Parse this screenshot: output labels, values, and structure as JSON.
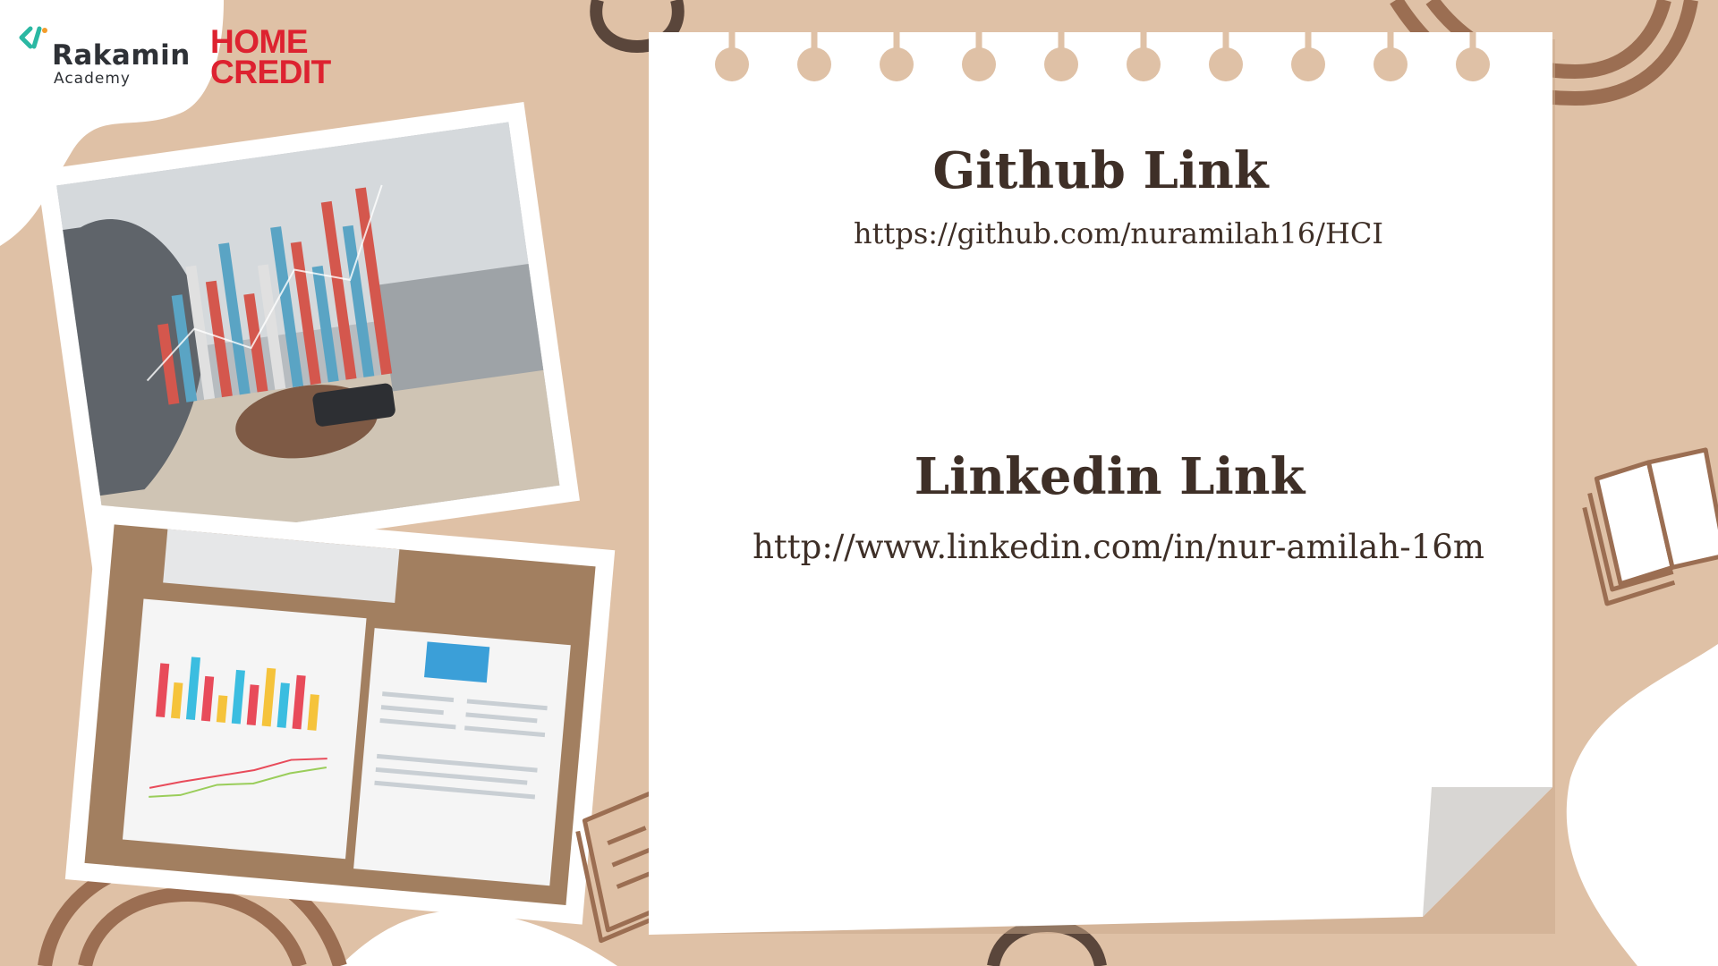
{
  "brand": {
    "rakamin_name": "Rakamin",
    "rakamin_sub": "Academy",
    "home_credit_line1": "HOME",
    "home_credit_line2": "CREDIT",
    "home_credit_color": "#dd2230"
  },
  "github": {
    "title": "Github Link",
    "url": "https://github.com/nuramilah16/HCI"
  },
  "linkedin": {
    "title": "Linkedin Link",
    "url": "http://www.linkedin.com/in/nur-amilah-16m"
  },
  "colors": {
    "background": "#dfc1a6",
    "blob_light": "#ffffff",
    "accent_brown": "#5a463b",
    "text_dark": "#3e2f27",
    "line_brown": "#9b6e52"
  }
}
